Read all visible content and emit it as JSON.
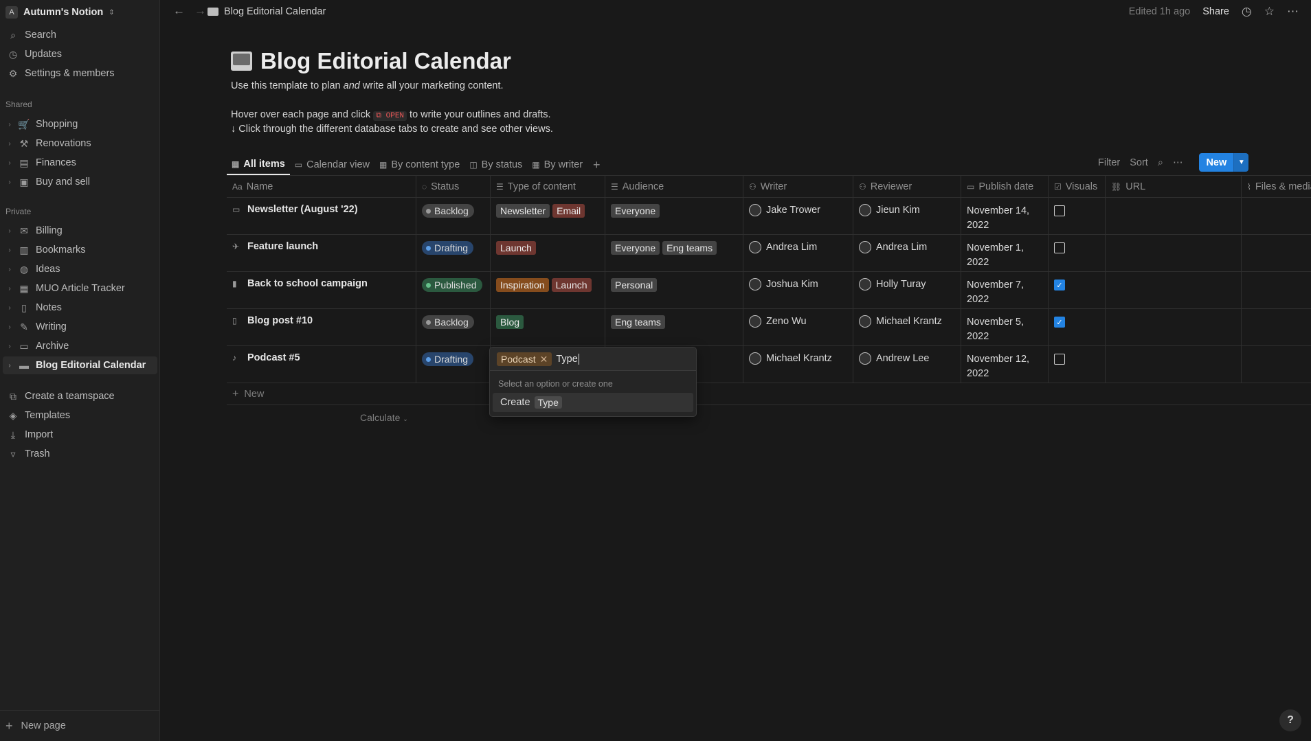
{
  "workspace": {
    "avatar": "A",
    "name": "Autumn's Notion"
  },
  "sidebar": {
    "top": [
      {
        "icon": "search-icon",
        "glyph": "⌕",
        "label": "Search"
      },
      {
        "icon": "clock-icon",
        "glyph": "◷",
        "label": "Updates"
      },
      {
        "icon": "gear-icon",
        "glyph": "⚙",
        "label": "Settings & members"
      }
    ],
    "shared_heading": "Shared",
    "shared": [
      {
        "icon": "cart-icon",
        "glyph": "🛒",
        "label": "Shopping"
      },
      {
        "icon": "hammer-icon",
        "glyph": "⚒",
        "label": "Renovations"
      },
      {
        "icon": "card-icon",
        "glyph": "▤",
        "label": "Finances"
      },
      {
        "icon": "money-icon",
        "glyph": "▣",
        "label": "Buy and sell"
      }
    ],
    "private_heading": "Private",
    "private": [
      {
        "icon": "mail-icon",
        "glyph": "✉",
        "label": "Billing"
      },
      {
        "icon": "book-icon",
        "glyph": "▥",
        "label": "Bookmarks"
      },
      {
        "icon": "bulb-icon",
        "glyph": "◍",
        "label": "Ideas"
      },
      {
        "icon": "keyboard-icon",
        "glyph": "▦",
        "label": "MUO Article Tracker"
      },
      {
        "icon": "doc-icon",
        "glyph": "▯",
        "label": "Notes"
      },
      {
        "icon": "pencil-icon",
        "glyph": "✎",
        "label": "Writing"
      },
      {
        "icon": "archive-icon",
        "glyph": "▭",
        "label": "Archive"
      },
      {
        "icon": "monitor-icon",
        "glyph": "▬",
        "label": "Blog Editorial Calendar"
      }
    ],
    "bottom": [
      {
        "icon": "teamspace-icon",
        "glyph": "⧉",
        "label": "Create a teamspace"
      },
      {
        "icon": "templates-icon",
        "glyph": "◈",
        "label": "Templates"
      },
      {
        "icon": "import-icon",
        "glyph": "⤓",
        "label": "Import"
      },
      {
        "icon": "trash-icon",
        "glyph": "▿",
        "label": "Trash"
      }
    ],
    "new_page": "New page"
  },
  "topbar": {
    "breadcrumb": "Blog Editorial Calendar",
    "edited": "Edited 1h ago",
    "share": "Share"
  },
  "page": {
    "title": "Blog Editorial Calendar",
    "desc1_a": "Use this template to plan ",
    "desc1_em": "and",
    "desc1_b": " write all your marketing content.",
    "desc2_a": "Hover over each page and click ",
    "desc2_code": "⧉ OPEN",
    "desc2_b": " to write your outlines and drafts.",
    "desc3": "↓ Click through the different database tabs to create and see other views."
  },
  "tabs": [
    "All items",
    "Calendar view",
    "By content type",
    "By status",
    "By writer"
  ],
  "view_tools": {
    "filter": "Filter",
    "sort": "Sort",
    "new": "New"
  },
  "columns": [
    "Name",
    "Status",
    "Type of content",
    "Audience",
    "Writer",
    "Reviewer",
    "Publish date",
    "Visuals",
    "URL",
    "Files & media"
  ],
  "colors": {
    "backlog_bg": "#444444",
    "backlog_dot": "#9b9b9b",
    "drafting_bg": "#28456c",
    "drafting_dot": "#5ea0e8",
    "published_bg": "#2b593f",
    "published_dot": "#66c08a",
    "tag_gray": "#444444",
    "tag_brown": "#5c4327",
    "tag_orange": "#854c1d",
    "tag_red": "#6e3630",
    "tag_green": "#2b593f",
    "accent": "#2383e2"
  },
  "rows": [
    {
      "icon": "calendar-icon",
      "glyph": "▭",
      "name": "Newsletter (August '22)",
      "status": "Backlog",
      "status_kind": "backlog",
      "types": [
        {
          "label": "Newsletter",
          "color": "#444444"
        },
        {
          "label": "Email",
          "color": "#6e3630"
        }
      ],
      "audience": [
        "Everyone"
      ],
      "writer": "Jake Trower",
      "reviewer": "Jieun Kim",
      "date1": "November 14,",
      "date2": "2022",
      "visuals": false
    },
    {
      "icon": "rocket-icon",
      "glyph": "✈",
      "name": "Feature launch",
      "status": "Drafting",
      "status_kind": "drafting",
      "types": [
        {
          "label": "Launch",
          "color": "#6e3630"
        }
      ],
      "audience": [
        "Everyone",
        "Eng teams"
      ],
      "writer": "Andrea Lim",
      "reviewer": "Andrea Lim",
      "date1": "November 1,",
      "date2": "2022",
      "visuals": false
    },
    {
      "icon": "backpack-icon",
      "glyph": "▮",
      "name": "Back to school campaign",
      "status": "Published",
      "status_kind": "published",
      "types": [
        {
          "label": "Inspiration",
          "color": "#854c1d"
        },
        {
          "label": "Launch",
          "color": "#6e3630"
        }
      ],
      "audience": [
        "Personal"
      ],
      "writer": "Joshua Kim",
      "reviewer": "Holly Turay",
      "date1": "November 7,",
      "date2": "2022",
      "visuals": true
    },
    {
      "icon": "doc-icon",
      "glyph": "▯",
      "name": "Blog post #10",
      "status": "Backlog",
      "status_kind": "backlog",
      "types": [
        {
          "label": "Blog",
          "color": "#2b593f"
        }
      ],
      "audience": [
        "Eng teams"
      ],
      "writer": "Zeno Wu",
      "reviewer": "Michael Krantz",
      "date1": "November 5,",
      "date2": "2022",
      "visuals": true
    },
    {
      "icon": "mic-icon",
      "glyph": "♪",
      "name": "Podcast #5",
      "status": "Drafting",
      "status_kind": "drafting",
      "types": [],
      "audience": [],
      "writer": "Michael Krantz",
      "reviewer": "Andrew Lee",
      "date1": "November 12,",
      "date2": "2022",
      "visuals": false
    }
  ],
  "new_row": "New",
  "calculate": "Calculate",
  "popup": {
    "chip": "Podcast",
    "input_value": "Type",
    "hint": "Select an option or create one",
    "create": "Create",
    "create_value": "Type"
  },
  "help": "?"
}
